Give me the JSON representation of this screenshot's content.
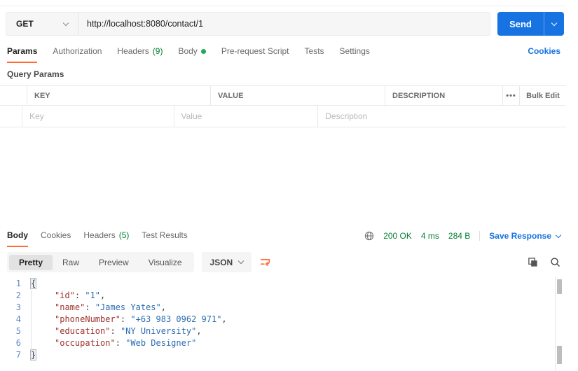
{
  "request": {
    "method": "GET",
    "url": "http://localhost:8080/contact/1",
    "send_label": "Send",
    "tabs": [
      {
        "label": "Params",
        "active": true
      },
      {
        "label": "Authorization"
      },
      {
        "label": "Headers",
        "count": "(9)"
      },
      {
        "label": "Body",
        "has_dot": true
      },
      {
        "label": "Pre-request Script"
      },
      {
        "label": "Tests"
      },
      {
        "label": "Settings"
      }
    ],
    "cookies_link": "Cookies",
    "section_label": "Query Params",
    "params_table": {
      "columns": [
        "KEY",
        "VALUE",
        "DESCRIPTION"
      ],
      "more_icon": "•••",
      "bulk_edit_label": "Bulk Edit",
      "row_placeholders": [
        "Key",
        "Value",
        "Description"
      ]
    }
  },
  "response": {
    "tabs": [
      {
        "label": "Body",
        "active": true
      },
      {
        "label": "Cookies"
      },
      {
        "label": "Headers",
        "count": "(5)"
      },
      {
        "label": "Test Results"
      }
    ],
    "status": "200 OK",
    "time": "4 ms",
    "size": "284 B",
    "save_label": "Save Response",
    "view_tabs": [
      "Pretty",
      "Raw",
      "Preview",
      "Visualize"
    ],
    "format_selected": "JSON",
    "body_json": {
      "id": "1",
      "name": "James Yates",
      "phoneNumber": "+63 983 0962 971",
      "education": "NY University",
      "occupation": "Web Designer"
    },
    "code_lines": [
      {
        "num": "1",
        "open": "{"
      },
      {
        "num": "2",
        "key": "\"id\"",
        "sep": ": ",
        "val": "\"1\"",
        "end": ","
      },
      {
        "num": "3",
        "key": "\"name\"",
        "sep": ": ",
        "val": "\"James Yates\"",
        "end": ","
      },
      {
        "num": "4",
        "key": "\"phoneNumber\"",
        "sep": ": ",
        "val": "\"+63 983 0962 971\"",
        "end": ","
      },
      {
        "num": "5",
        "key": "\"education\"",
        "sep": ": ",
        "val": "\"NY University\"",
        "end": ","
      },
      {
        "num": "6",
        "key": "\"occupation\"",
        "sep": ": ",
        "val": "\"Web Designer\"",
        "end": ""
      },
      {
        "num": "7",
        "close": "}"
      }
    ]
  },
  "colors": {
    "accent_orange": "#ff6c37",
    "primary_blue": "#1673e1",
    "success_green": "#007f31",
    "json_key": "#a0342c",
    "json_string": "#2b6cb3",
    "line_number_blue": "#5c87c5"
  }
}
